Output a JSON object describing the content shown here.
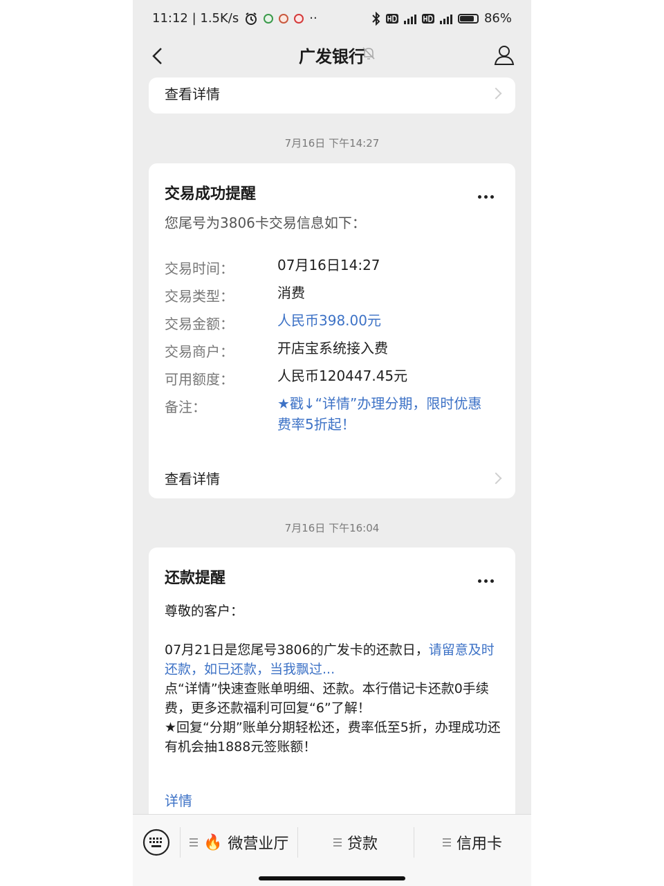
{
  "status_bar": {
    "time_speed": "11:12 | 1.5K/s",
    "battery": "86%"
  },
  "nav": {
    "title": "广发银行"
  },
  "top_card": {
    "view_details": "查看详情"
  },
  "msg1": {
    "timestamp": "7月16日 下午14:27",
    "title": "交易成功提醒",
    "intro": "您尾号为3806卡交易信息如下：",
    "rows": [
      {
        "label": "交易时间：",
        "value": "07月16日14:27"
      },
      {
        "label": "交易类型：",
        "value": "消费"
      },
      {
        "label": "交易金额：",
        "value": "人民币398.00元"
      },
      {
        "label": "交易商户：",
        "value": "开店宝系统接入费"
      },
      {
        "label": "可用额度：",
        "value": "人民币120447.45元"
      },
      {
        "label": "备注：",
        "value": "★戳↓“详情”办理分期，限时优惠费率5折起！"
      }
    ],
    "view_details": "查看详情"
  },
  "msg2": {
    "timestamp": "7月16日 下午16:04",
    "title": "还款提醒",
    "greeting": "尊敬的客户：",
    "p1_plain": "07月21日是您尾号3806的广发卡的还款日，",
    "p1_blue": "请留意及时还款，如已还款，当我飘过...",
    "p2": "点“详情”快速查账单明细、还款。本行借记卡还款0手续费，更多还款福利可回复“6”了解！",
    "p3": "★回复“分期”账单分期轻松还，费率低至5折，办理成功还有机会抽1888元签账额！",
    "details": "详情"
  },
  "bottom_menu": {
    "items": [
      {
        "label": "微营业厅",
        "emoji": "🔥"
      },
      {
        "label": "贷款"
      },
      {
        "label": "信用卡"
      }
    ]
  },
  "colors": {
    "link_blue": "#3d72c6",
    "background": "#ededed",
    "card": "#ffffff"
  }
}
